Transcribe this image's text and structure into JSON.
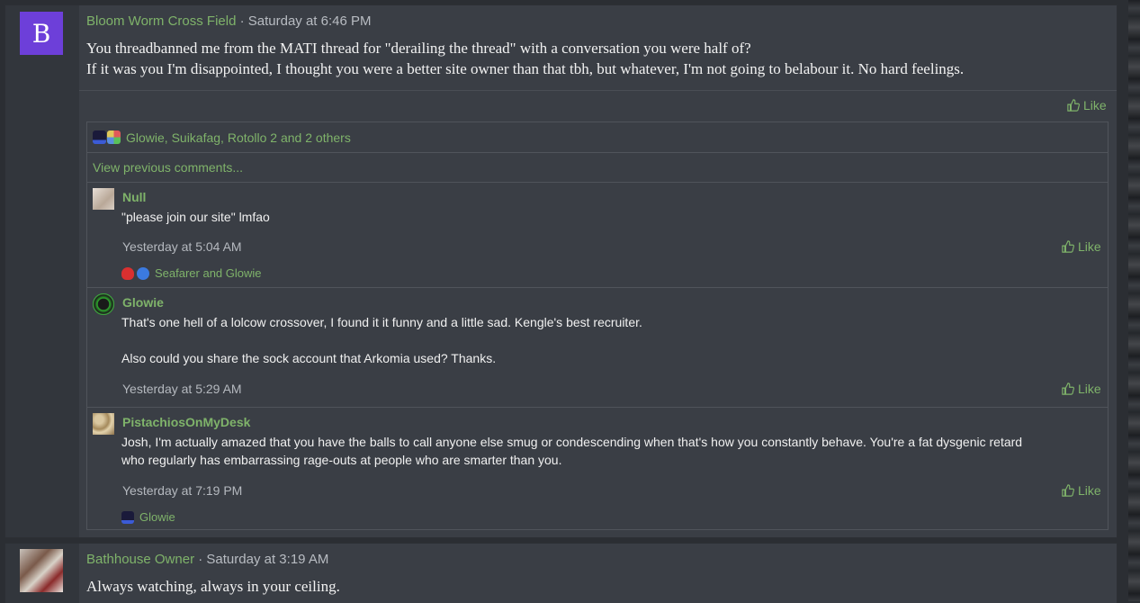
{
  "posts": [
    {
      "avatar_letter": "B",
      "username": "Bloom Worm Cross Field",
      "separator": " · ",
      "timestamp": "Saturday at 6:46 PM",
      "body_lines": [
        "You threadbanned me from the MATI thread for \"derailing the thread\" with a conversation you were half of?",
        "If it was you I'm disappointed, I thought you were a better site owner than that tbh, but whatever, I'm not going to belabour it. No hard feelings."
      ],
      "like_label": "Like",
      "reactions_text": "Glowie, Suikafag, Rotollo 2 and 2 others",
      "view_previous": "View previous comments...",
      "comments": [
        {
          "username": "Null",
          "text_lines": [
            "\"please join our site\" lmfao"
          ],
          "timestamp": "Yesterday at 5:04 AM",
          "like_label": "Like",
          "reactions_text": "Seafarer and Glowie"
        },
        {
          "username": "Glowie",
          "text_lines": [
            "That's one hell of a lolcow crossover, I found it it funny and a little sad. Kengle's best recruiter.",
            "",
            "Also could you share the sock account that Arkomia used? Thanks."
          ],
          "timestamp": "Yesterday at 5:29 AM",
          "like_label": "Like"
        },
        {
          "username": "PistachiosOnMyDesk",
          "text_lines": [
            "Josh, I'm actually amazed that you have the balls to call anyone else smug or condescending when that's how you constantly behave. You're a fat dysgenic retard",
            "who regularly has embarrassing rage-outs at people who are smarter than you."
          ],
          "timestamp": "Yesterday at 7:19 PM",
          "like_label": "Like",
          "reactions_text": "Glowie"
        }
      ]
    },
    {
      "username": "Bathhouse Owner",
      "separator": " · ",
      "timestamp": "Saturday at 3:19 AM",
      "body_lines": [
        "Always watching, always in your ceiling."
      ]
    }
  ],
  "colors": {
    "accent_green": "#7fb36a",
    "avatar_purple": "#6d3fd9",
    "panel": "#3a3e45",
    "background": "#2b2e33"
  },
  "icons": {
    "like": "thumbs-up-icon"
  }
}
